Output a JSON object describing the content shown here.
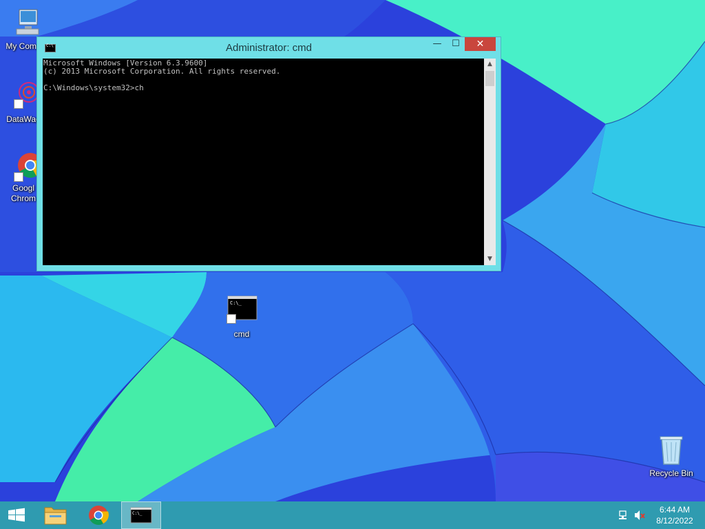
{
  "desktop": {
    "icons": [
      {
        "label_lines": [
          "My Comp"
        ]
      },
      {
        "label_lines": [
          "DataWag"
        ]
      },
      {
        "label_lines": [
          "Googl",
          "Chrom"
        ]
      },
      {
        "label_lines": [
          "cmd"
        ]
      },
      {
        "label_lines": [
          "Recycle Bin"
        ]
      }
    ]
  },
  "window": {
    "title": "Administrator: cmd",
    "buttons": {
      "minimize": "—",
      "maximize": "☐",
      "close": "✕"
    },
    "console_lines": [
      "Microsoft Windows [Version 6.3.9600]",
      "(c) 2013 Microsoft Corporation. All rights reserved.",
      "",
      "C:\\Windows\\system32>ch"
    ],
    "console_text": "Microsoft Windows [Version 6.3.9600]\n(c) 2013 Microsoft Corporation. All rights reserved.\n\nC:\\Windows\\system32>ch"
  },
  "taskbar": {
    "items": [
      "start-button",
      "file-explorer",
      "chrome",
      "cmd"
    ],
    "tray": {
      "icons": [
        "network-icon",
        "volume-muted-icon"
      ],
      "time": "6:44 AM",
      "date": "8/12/2022"
    }
  },
  "colors": {
    "window_frame": "#6fdfe7",
    "close_button": "#c9463d",
    "taskbar": "#2f9bb0",
    "console_bg": "#000000",
    "console_fg": "#c0c0c0"
  }
}
